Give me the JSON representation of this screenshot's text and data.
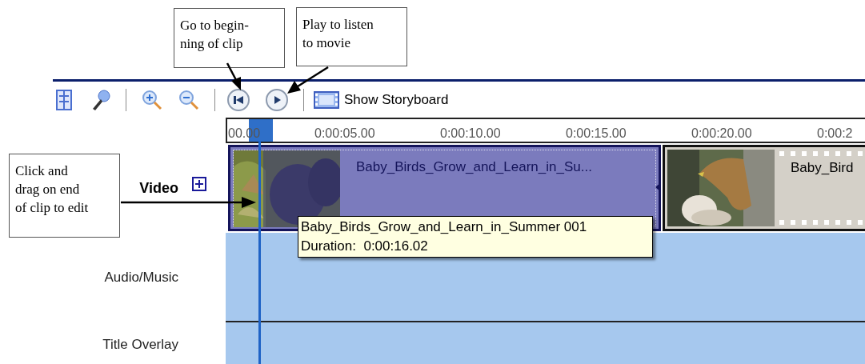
{
  "callouts": [
    {
      "text": "Go to begin-\nning of clip"
    },
    {
      "text": "Play to listen\nto movie"
    },
    {
      "text": "Click and\ndrag on end\nof clip to edit"
    }
  ],
  "toolbar": {
    "storyboard_label": "Show Storyboard"
  },
  "ruler": {
    "labels": [
      "00.00",
      "0:00:05.00",
      "0:00:10.00",
      "0:00:15.00",
      "0:00:20.00",
      "0:00:2"
    ]
  },
  "tracks": [
    {
      "name": "Video",
      "emphasized": true,
      "expandable": true,
      "clips": [
        {
          "title": "Baby_Birds_Grow_and_Learn_in_Su...",
          "selected": true
        },
        {
          "title": "Baby_Bird",
          "selected": false
        }
      ]
    },
    {
      "name": "Audio/Music",
      "emphasized": false,
      "expandable": false
    },
    {
      "name": "Title Overlay",
      "emphasized": false,
      "expandable": false
    }
  ],
  "tooltip": {
    "lines": [
      "Baby_Birds_Grow_and_Learn_in_Summer 001",
      "Duration:  0:00:16.02"
    ]
  }
}
